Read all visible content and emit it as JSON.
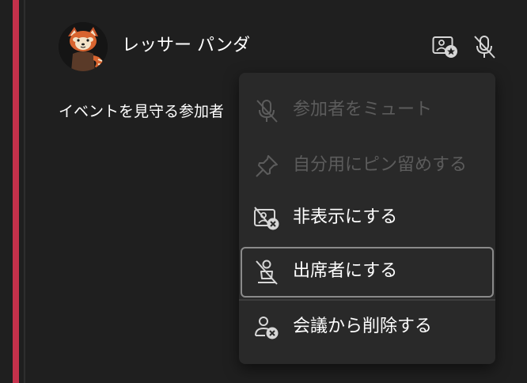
{
  "participant": {
    "name": "レッサー パンダ",
    "avatar_icon": "red-panda-avatar",
    "actions": [
      {
        "icon": "spotlight-icon"
      },
      {
        "icon": "mic-off-icon"
      }
    ]
  },
  "section": {
    "label": "イベントを見守る参加者"
  },
  "menu": {
    "items": [
      {
        "label": "参加者をミュート",
        "icon": "mic-off-icon",
        "disabled": true
      },
      {
        "label": "自分用にピン留めする",
        "icon": "pin-icon",
        "disabled": true
      },
      {
        "label": "非表示にする",
        "icon": "hide-video-icon",
        "disabled": false
      },
      {
        "label": "出席者にする",
        "icon": "make-attendee-icon",
        "disabled": false,
        "focused": true
      },
      {
        "label": "会議から削除する",
        "icon": "remove-person-icon",
        "disabled": false
      }
    ]
  },
  "colors": {
    "background": "#1f1f1f",
    "accent_bar": "#c4314b",
    "menu_bg": "#292929",
    "text": "#ffffff",
    "disabled_text": "#5c5c5c"
  }
}
